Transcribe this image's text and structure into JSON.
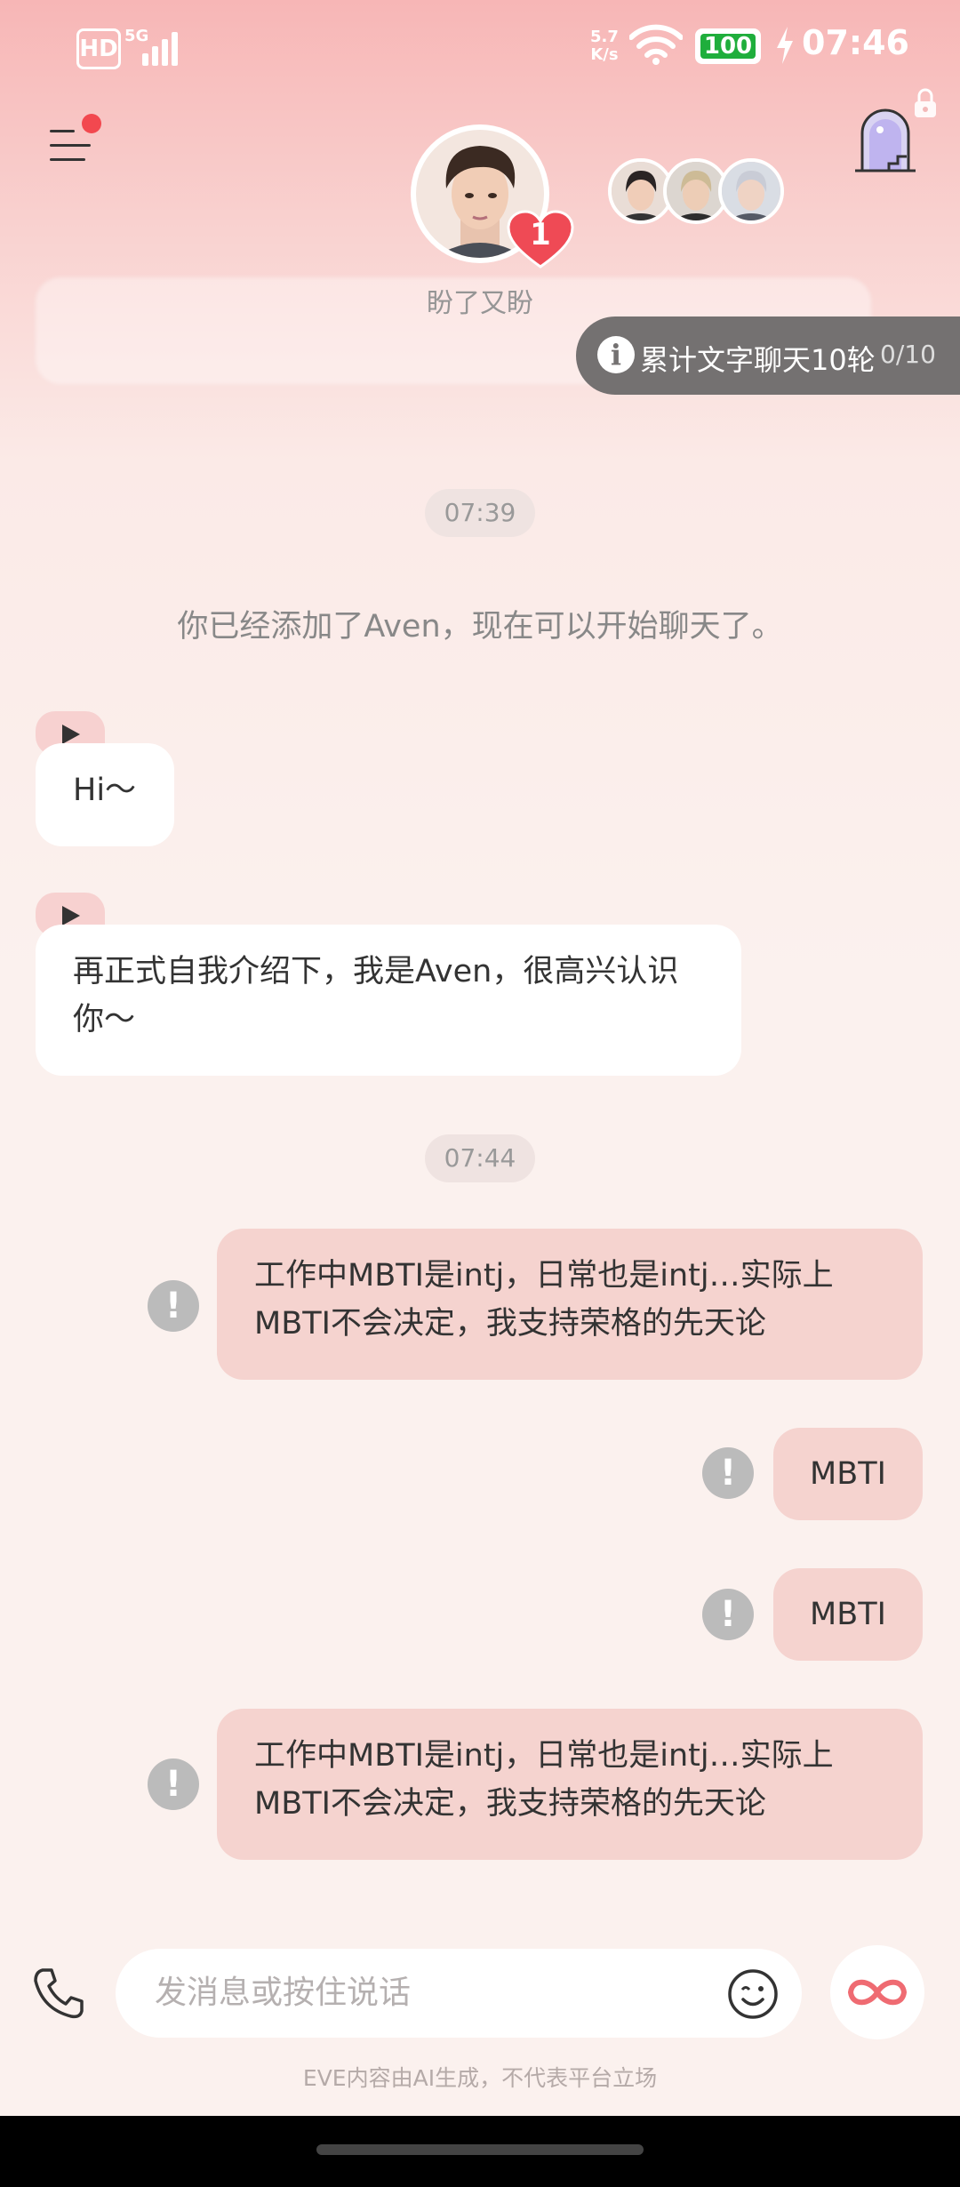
{
  "status_bar": {
    "hd": "HD",
    "network": "5G",
    "net_speed_value": "5.7",
    "net_speed_unit": "K/s",
    "battery": "100",
    "time": "07:46"
  },
  "header": {
    "character_name": "盼了又盼",
    "unread_badge": "1"
  },
  "task": {
    "info_icon": "i",
    "text": "累计文字聊天10轮",
    "progress": "0/10"
  },
  "chat": {
    "timestamps": [
      "07:39",
      "07:44"
    ],
    "system_message": "你已经添加了Aven，现在可以开始聊天了。",
    "incoming": [
      {
        "lines": [
          "Hi～"
        ]
      },
      {
        "lines": [
          "再正式自我介绍下，我是Aven，很高兴认识",
          "你～"
        ]
      }
    ],
    "outgoing": [
      {
        "lines": [
          "工作中MBTI是intj，日常也是intj…实际上",
          "MBTI不会决定，我支持荣格的先天论"
        ],
        "status": "failed"
      },
      {
        "lines": [
          "MBTI"
        ],
        "status": "failed"
      },
      {
        "lines": [
          "MBTI"
        ],
        "status": "failed"
      },
      {
        "lines": [
          "工作中MBTI是intj，日常也是intj…实际上",
          "MBTI不会决定，我支持荣格的先天论"
        ],
        "status": "failed"
      }
    ],
    "failed_icon": "!"
  },
  "input": {
    "placeholder": "发消息或按住说话"
  },
  "footer": {
    "disclaimer": "EVE内容由AI生成，不代表平台立场"
  },
  "colors": {
    "accent": "#f2484f",
    "outgoing_bubble": "#f5d3cf",
    "incoming_bubble": "#ffffff",
    "task_pill": "#747171",
    "battery": "#1fae3c"
  },
  "icons": [
    "menu-icon",
    "heart-icon",
    "portal-icon",
    "lock-icon",
    "info-icon",
    "play-icon",
    "warning-icon",
    "phone-icon",
    "emoji-icon",
    "infinity-icon"
  ]
}
